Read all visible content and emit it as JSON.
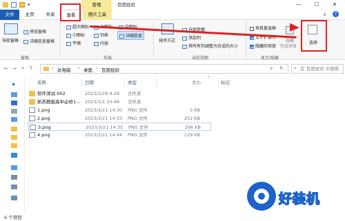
{
  "window": {
    "title": "百度经验",
    "manage_tab": "管理",
    "controls": {
      "minimize": "—",
      "maximize": "☐",
      "close": "✕"
    }
  },
  "ribbon_tabs": {
    "file": "文件",
    "home": "主页",
    "share": "共享",
    "view": "查看",
    "picture_tools": "图片工具"
  },
  "ribbon": {
    "panes": {
      "nav_pane": "导航窗格",
      "preview_pane": "预览窗格",
      "details_pane": "详细信息窗格",
      "group_label": "窗格"
    },
    "layout": {
      "extra_large_icons": "超大图标",
      "large_icons": "大图标",
      "medium_icons": "中图标",
      "small_icons": "小图标",
      "list": "列表",
      "details": "详细信息",
      "tiles": "平铺",
      "content": "内容",
      "group_label": "布局"
    },
    "current_view": {
      "sort_by": "排序方式",
      "group_by": "分组依据",
      "add_columns": "添加列",
      "size_all_columns": "将所有列调整为合适的大小",
      "group_label": "当前视图"
    },
    "show_hide": {
      "item_checkboxes": {
        "label": "项目复选框",
        "checked": false
      },
      "file_extensions": {
        "label": "文件扩展名",
        "checked": true
      },
      "hidden_items": {
        "label": "隐藏的项目",
        "checked": true
      },
      "hide_selected": "隐藏",
      "hide_selected_sub": "所选项目",
      "group_label": "显示/隐藏"
    },
    "options": "选项"
  },
  "address": {
    "path": [
      "此电脑",
      "桌面",
      "百度经验"
    ],
    "search_placeholder": "在 百度经验 中搜索"
  },
  "columns": {
    "name": "名称",
    "date": "日期",
    "type": "类型",
    "size": "大小",
    "tags": "标记"
  },
  "files": [
    {
      "name": "软件测试-002",
      "date": "2023/2/28 9:28",
      "type": "文件夹",
      "size": "",
      "icon": "folder"
    },
    {
      "name": "新苏教版高中必修1...",
      "date": "2023/3/1 14:48",
      "type": "文件夹",
      "size": "",
      "icon": "folder"
    },
    {
      "name": "1.png",
      "date": "2023/3/21 14:30",
      "type": "PNG 文件",
      "size": "5 KB",
      "icon": "png"
    },
    {
      "name": "2.png",
      "date": "2023/3/21 14:33",
      "type": "PNG 文件",
      "size": "252 KB",
      "icon": "png"
    },
    {
      "name": "3.png",
      "date": "2023/3/21 14:35",
      "type": "PNG 文件",
      "size": "296 KB",
      "icon": "png"
    },
    {
      "name": "4.png",
      "date": "2023/3/21 14:44",
      "type": "PNG 文件",
      "size": "129 KB",
      "icon": "png"
    }
  ],
  "status": {
    "item_count": "6 个项目"
  },
  "watermark": {
    "text": "好装机"
  },
  "colors": {
    "file_tab": "#1a5fb4",
    "picture_tools": "#f6eb9c",
    "annotation": "#e02020",
    "folder": "#f0c24c",
    "watermark": "#1d63c9"
  }
}
